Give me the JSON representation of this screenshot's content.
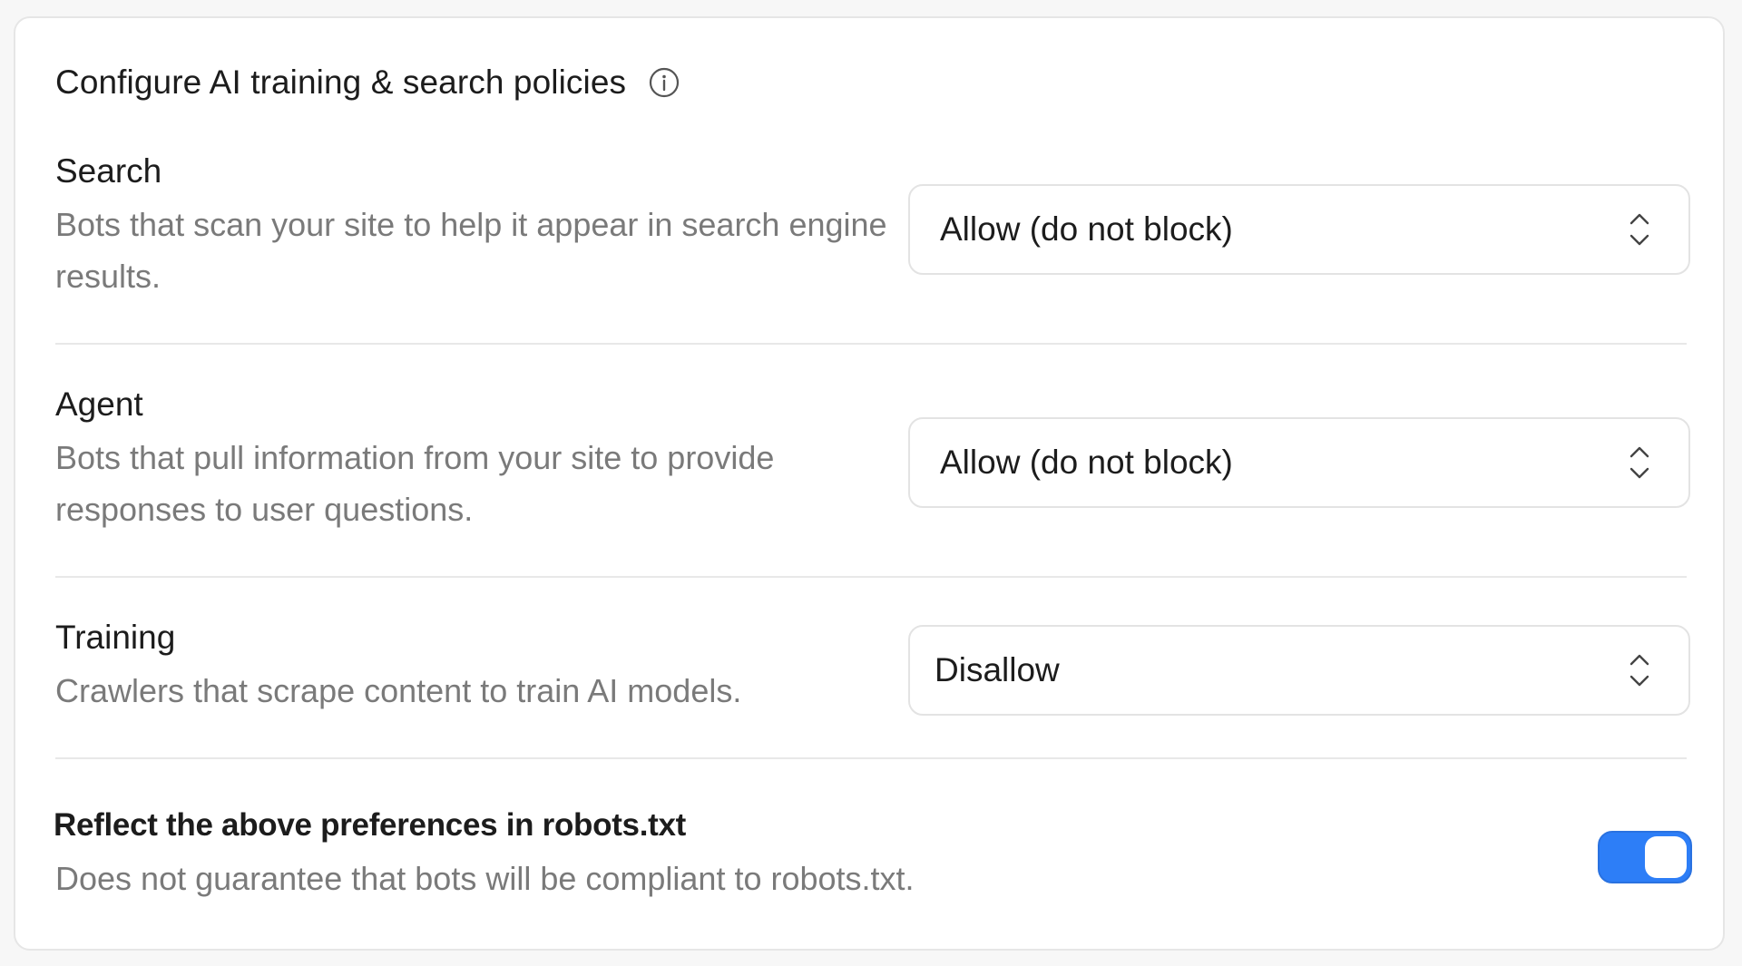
{
  "header": {
    "title": "Configure AI training & search policies",
    "info_icon": "info-circle-icon"
  },
  "rows": [
    {
      "title": "Search",
      "description": "Bots that scan your site to help it appear in search engine results.",
      "select_value": "Allow (do not block)",
      "select_icon": "chevron-up-down-icon"
    },
    {
      "title": "Agent",
      "description": "Bots that pull information from your site to provide responses to user questions.",
      "select_value": "Allow (do not block)",
      "select_icon": "chevron-up-down-icon"
    },
    {
      "title": "Training",
      "description": "Crawlers that scrape content to train AI models.",
      "select_value": "Disallow",
      "select_icon": "chevron-up-down-icon"
    }
  ],
  "robots": {
    "title": "Reflect the above preferences in robots.txt",
    "description": "Does not guarantee that bots will be compliant to robots.txt.",
    "toggle_on": true
  },
  "colors": {
    "toggle_on": "#2d7ef7",
    "muted_text": "#7a7a7a",
    "divider": "#e8e8e8"
  }
}
